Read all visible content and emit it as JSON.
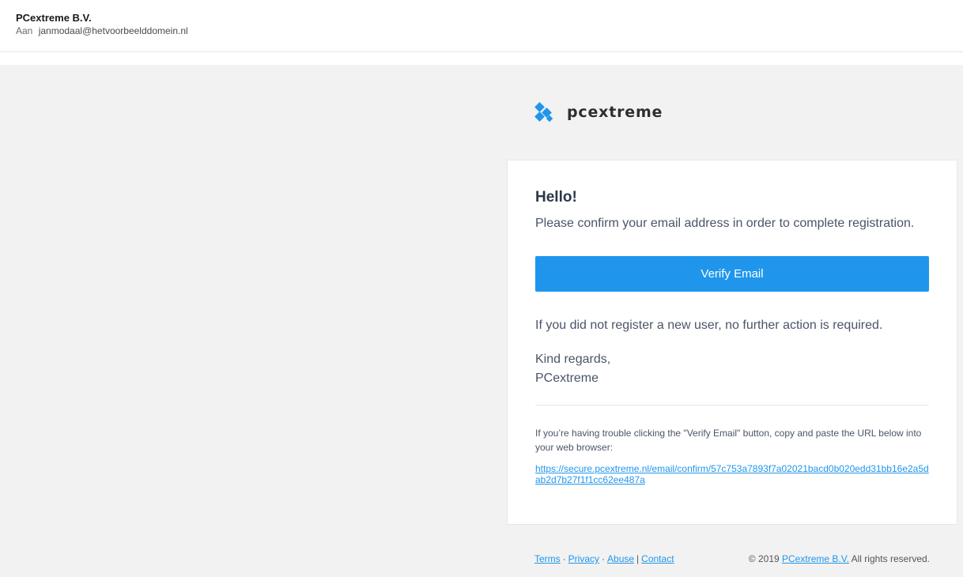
{
  "header": {
    "sender": "PCextreme B.V.",
    "to_label": "Aan",
    "to_address": "janmodaal@hetvoorbeelddomein.nl"
  },
  "logo": {
    "text": "pcextreme",
    "icon": "pcextreme-logo-icon",
    "color": "#1f96ec"
  },
  "email": {
    "greeting": "Hello!",
    "intro": "Please confirm your email address in order to complete registration.",
    "button_label": "Verify Email",
    "notice": "If you did not register a new user, no further action is required.",
    "regards_line1": "Kind regards,",
    "regards_line2": "PCextreme",
    "trouble_text": "If you’re having trouble clicking the \"Verify Email\" button, copy and paste the URL below into your web browser:",
    "confirm_url": "https://secure.pcextreme.nl/email/confirm/57c753a7893f7a02021bacd0b020edd31bb16e2a5dab2d7b27f1f1cc62ee487a"
  },
  "footer": {
    "links": {
      "terms": "Terms",
      "privacy": "Privacy",
      "abuse": "Abuse",
      "contact": "Contact"
    },
    "separator_dot": "·",
    "separator_pipe": "|",
    "copyright_prefix": "© 2019",
    "company_link": "PCextreme B.V.",
    "copyright_suffix": "All rights reserved."
  },
  "colors": {
    "accent": "#1f96ec",
    "background": "#f2f2f2",
    "card": "#ffffff"
  }
}
